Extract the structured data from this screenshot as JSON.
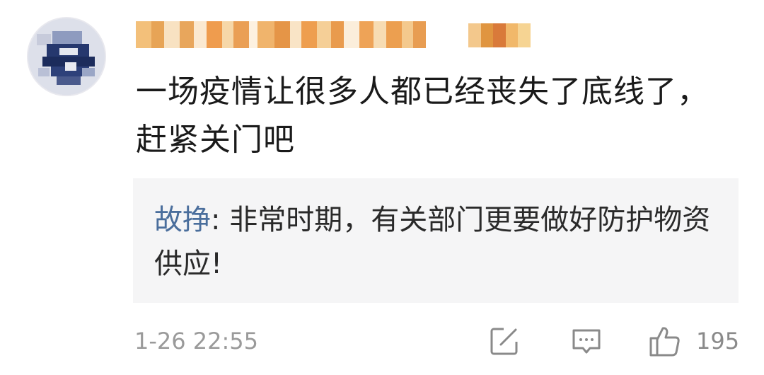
{
  "comment": {
    "text": "一场疫情让很多人都已经丧失了底线了，赶紧关门吧",
    "timestamp": "1-26 22:55",
    "like_count": "195"
  },
  "reply": {
    "author": "故挣",
    "separator": ": ",
    "text": "非常时期，有关部门更要做好防护物资供应!"
  },
  "icons": {
    "share": "share-edit-icon",
    "reply": "comment-bubble-icon",
    "like": "thumbs-up-icon"
  },
  "colors": {
    "reply_author": "#4a6e9c",
    "reply_background": "#f5f5f6",
    "meta_text": "#9a9a9a"
  }
}
